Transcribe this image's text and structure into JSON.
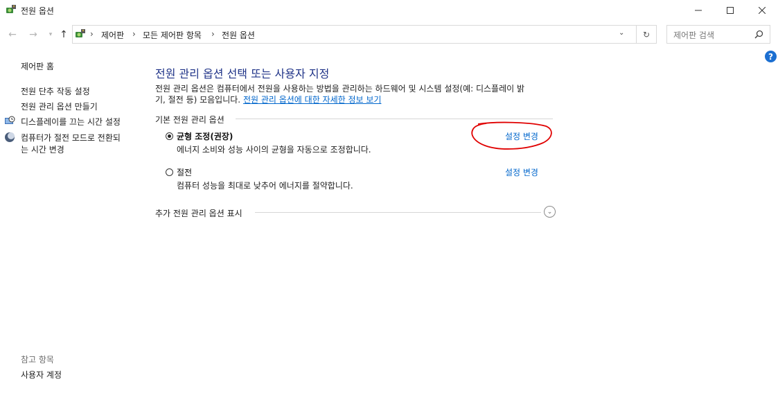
{
  "window": {
    "title": "전원 옵션"
  },
  "address": {
    "crumbs": [
      "제어판",
      "모든 제어판 항목",
      "전원 옵션"
    ],
    "separator": "›"
  },
  "search": {
    "placeholder": "제어판 검색"
  },
  "sidebar": {
    "home": "제어판 홈",
    "items": [
      "전원 단추 작동 설정",
      "전원 관리 옵션 만들기",
      "디스플레이를 끄는 시간 설정",
      "컴퓨터가 절전 모드로 전환되",
      "는 시간 변경"
    ],
    "see_also_title": "참고 항목",
    "see_also_items": [
      "사용자 계정"
    ]
  },
  "main": {
    "heading": "전원 관리 옵션 선택 또는 사용자 지정",
    "description_line1": "전원 관리 옵션은 컴퓨터에서 전원을 사용하는 방법을 관리하는 하드웨어 및 시스템 설정(예: 디스플레이 밝",
    "description_line2_prefix": "기, 절전 등) 모음입니다. ",
    "description_link": "전원 관리 옵션에 대한 자세한 정보 보기",
    "group_title": "기본 전원 관리 옵션",
    "plans": [
      {
        "name": "균형 조정(권장)",
        "desc": "에너지 소비와 성능 사이의 균형을 자동으로 조정합니다.",
        "action": "설정 변경",
        "selected": true
      },
      {
        "name": "절전",
        "desc": "컴퓨터 성능을 최대로 낮추어 에너지를 절약합니다.",
        "action": "설정 변경",
        "selected": false
      }
    ],
    "more_plans": "추가 전원 관리 옵션 표시"
  },
  "colors": {
    "accent": "#0066cc",
    "heading": "#1e3287",
    "annotation": "#e00000"
  },
  "icons": {
    "title": "power-options-icon",
    "help": "help-icon",
    "expand": "chevron-down-icon",
    "display": "display-clock-icon",
    "sleep": "moon-icon"
  }
}
